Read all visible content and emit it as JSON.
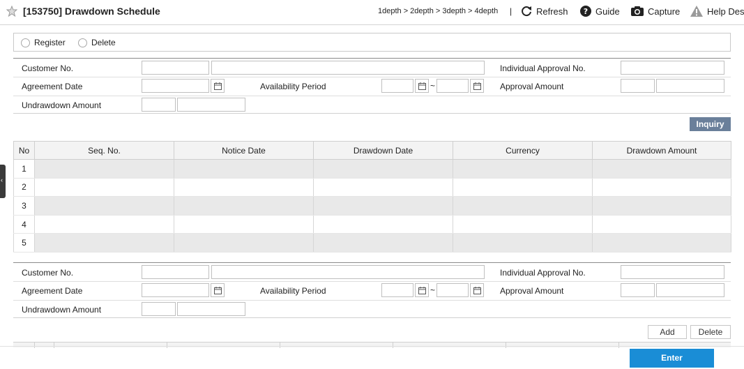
{
  "header": {
    "title": "[153750] Drawdown Schedule",
    "breadcrumb": "1depth > 2depth > 3depth > 4depth",
    "separator": "|",
    "tools": {
      "refresh": "Refresh",
      "guide": "Guide",
      "capture": "Capture",
      "help": "Help Des"
    }
  },
  "radios": {
    "register": "Register",
    "delete": "Delete"
  },
  "form": {
    "customer_no": "Customer No.",
    "individual_approval_no": "Individual Approval No.",
    "agreement_date": "Agreement Date",
    "availability_period": "Availability Period",
    "approval_amount": "Approval Amount",
    "undrawdown_amount": "Undrawdown Amount",
    "tilde": "~"
  },
  "buttons": {
    "inquiry": "Inquiry",
    "add": "Add",
    "delete": "Delete",
    "enter": "Enter"
  },
  "grid": {
    "columns": [
      "No",
      "Seq. No.",
      "Notice Date",
      "Drawdown Date",
      "Currency",
      "Drawdown Amount"
    ],
    "rows": [
      "1",
      "2",
      "3",
      "4",
      "5"
    ]
  },
  "colors": {
    "accent": "#1a8dd6",
    "inquiry": "#6a7f9a",
    "row_alt": "#e9e9e9"
  }
}
